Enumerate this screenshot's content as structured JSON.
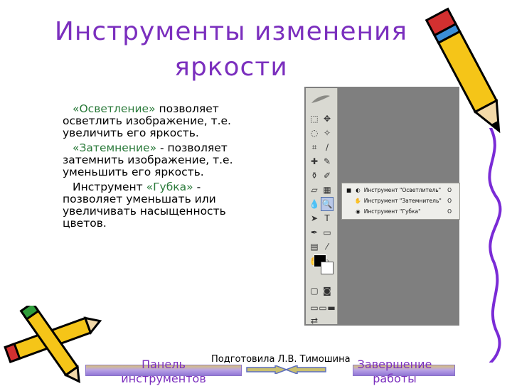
{
  "slide": {
    "title": "Инструменты изменения яркости",
    "paragraphs": [
      {
        "term": "«Осветление»",
        "rest": " позволяет осветлить изображение, т.е. увеличить его яркость."
      },
      {
        "term": "«Затемнение»",
        "rest": " - позволяет затемнить изображение, т.е. уменьшить его яркость."
      },
      {
        "lead": "Инструмент ",
        "term": "«Губка»",
        "rest": " - позволяет уменьшать или увеличивать насыщенность цветов."
      }
    ],
    "credit": "Подготовила Л.В. Тимошина"
  },
  "flyout": {
    "items": [
      {
        "label": "Инструмент \"Осветлитель\"",
        "key": "O",
        "icon": "dodge-icon",
        "active": true
      },
      {
        "label": "Инструмент \"Затемнитель\"",
        "key": "O",
        "icon": "burn-icon",
        "active": false
      },
      {
        "label": "Инструмент \"Губка\"",
        "key": "O",
        "icon": "sponge-icon",
        "active": false
      }
    ]
  },
  "nav": {
    "left_label": "Панель инструментов",
    "right_label": "Завершение работы"
  },
  "colors": {
    "title": "#7b2fbe",
    "highlight": "#2a7a3a"
  }
}
